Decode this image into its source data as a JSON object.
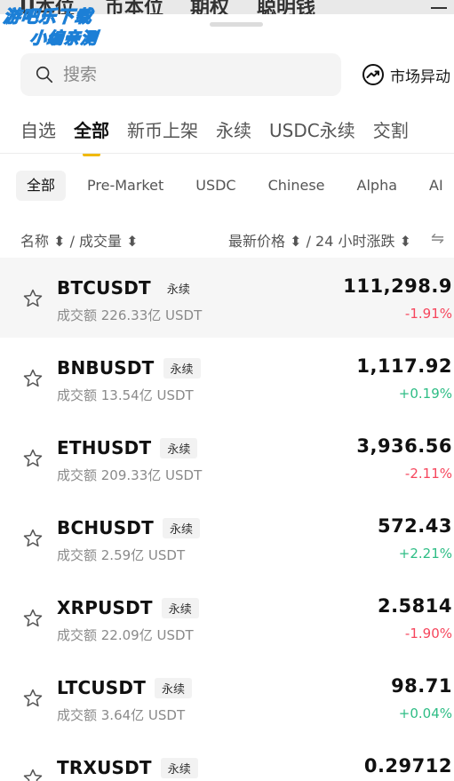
{
  "background_tabs": [
    "U本位",
    "币本位",
    "期权",
    "聪明钱"
  ],
  "watermark": {
    "line1": "游吧乐下载",
    "line2": "小编亲测"
  },
  "search": {
    "placeholder": "搜索"
  },
  "market_move_label": "市场异动",
  "main_tabs": [
    "自选",
    "全部",
    "新币上架",
    "永续",
    "USDC永续",
    "交割"
  ],
  "main_tabs_active_index": 1,
  "chips": [
    "全部",
    "Pre-Market",
    "USDC",
    "Chinese",
    "Alpha",
    "AI"
  ],
  "chips_active_index": 0,
  "columns": {
    "name_volume": "名称 ⬍ / 成交量 ⬍",
    "price_change": "最新价格 ⬍ / 24 小时涨跌 ⬍"
  },
  "rows": [
    {
      "pair": "BTCUSDT",
      "badge": "永续",
      "volume": "成交额 226.33亿 USDT",
      "price": "111,298.9",
      "change": "-1.91%",
      "direction": "down"
    },
    {
      "pair": "BNBUSDT",
      "badge": "永续",
      "volume": "成交额 13.54亿 USDT",
      "price": "1,117.92",
      "change": "+0.19%",
      "direction": "up"
    },
    {
      "pair": "ETHUSDT",
      "badge": "永续",
      "volume": "成交额 209.33亿 USDT",
      "price": "3,936.56",
      "change": "-2.11%",
      "direction": "down"
    },
    {
      "pair": "BCHUSDT",
      "badge": "永续",
      "volume": "成交额 2.59亿 USDT",
      "price": "572.43",
      "change": "+2.21%",
      "direction": "up"
    },
    {
      "pair": "XRPUSDT",
      "badge": "永续",
      "volume": "成交额 22.09亿 USDT",
      "price": "2.5814",
      "change": "-1.90%",
      "direction": "down"
    },
    {
      "pair": "LTCUSDT",
      "badge": "永续",
      "volume": "成交额 3.64亿 USDT",
      "price": "98.71",
      "change": "+0.04%",
      "direction": "up"
    },
    {
      "pair": "TRXUSDT",
      "badge": "永续",
      "volume": "",
      "price": "0.29712",
      "change": "",
      "direction": ""
    }
  ],
  "colors": {
    "accent": "#f0b90b",
    "down": "#f6465d",
    "up": "#2ebd85"
  }
}
